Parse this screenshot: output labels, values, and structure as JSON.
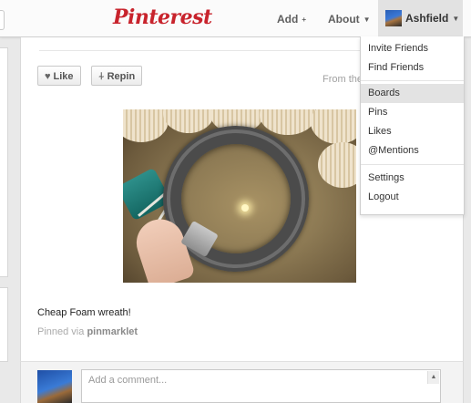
{
  "header": {
    "logo": "Pinterest",
    "add_label": "Add",
    "add_suffix": "+",
    "about_label": "About",
    "about_suffix": "▼",
    "user_name": "Ashfield",
    "user_suffix": "▼"
  },
  "pin": {
    "like_label": "Like",
    "repin_label": "Repin",
    "from_label": "From the",
    "caption": "Cheap Foam wreath!",
    "pinned_via_prefix": "Pinned via",
    "pinned_via_source": "pinmarklet"
  },
  "comment": {
    "placeholder": "Add a comment..."
  },
  "dropdown": {
    "items": [
      {
        "label": "Invite Friends"
      },
      {
        "label": "Find Friends"
      },
      {
        "label": "Boards"
      },
      {
        "label": "Pins"
      },
      {
        "label": "Likes"
      },
      {
        "label": "@Mentions"
      },
      {
        "label": "Settings"
      },
      {
        "label": "Logout"
      }
    ],
    "highlighted": "Boards"
  },
  "colors": {
    "brand": "#c8232c",
    "header_bg": "#fbfbfb",
    "highlight": "#e3e3e3"
  },
  "icons": {
    "like": "heart-icon",
    "repin": "pushpin-icon"
  }
}
